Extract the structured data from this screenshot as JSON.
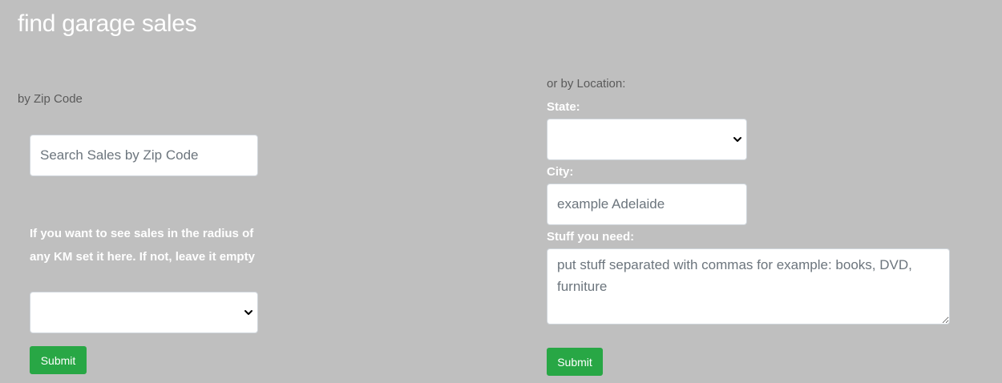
{
  "header": {
    "title": "find garage sales"
  },
  "zip_section": {
    "label": "by Zip Code",
    "zip_input": {
      "placeholder": "Search Sales by Zip Code",
      "value": ""
    },
    "radius_label": "If you want to see sales in the radius of any KM set it here. If not, leave it empty",
    "radius_select": {
      "selected": ""
    },
    "submit_label": "Submit"
  },
  "location_section": {
    "label": "or by Location:",
    "state_label": "State:",
    "state_select": {
      "selected": ""
    },
    "city_label": "City:",
    "city_input": {
      "placeholder": "example Adelaide",
      "value": ""
    },
    "stuff_label": "Stuff you need:",
    "stuff_textarea": {
      "placeholder": "put stuff separated with commas for example: books, DVD, furniture",
      "value": ""
    },
    "submit_label": "Submit"
  },
  "colors": {
    "background": "#bfbfbf",
    "submit_button": "#28a745",
    "input_background": "#ffffff"
  },
  "icons": {
    "select_arrow": "chevron-down-icon",
    "textarea_resize": "resize-handle-icon"
  }
}
